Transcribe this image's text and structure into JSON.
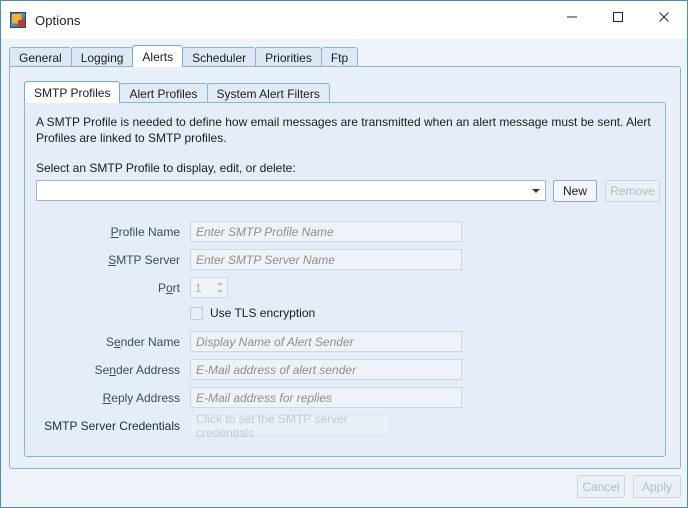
{
  "window": {
    "title": "Options",
    "icon": "app-icon",
    "controls": {
      "minimize": "minimize-icon",
      "maximize": "maximize-icon",
      "close": "close-icon"
    }
  },
  "outer_tabs": [
    {
      "label": "General",
      "selected": false
    },
    {
      "label": "Logging",
      "selected": false
    },
    {
      "label": "Alerts",
      "selected": true
    },
    {
      "label": "Scheduler",
      "selected": false
    },
    {
      "label": "Priorities",
      "selected": false
    },
    {
      "label": "Ftp",
      "selected": false
    }
  ],
  "inner_tabs": [
    {
      "label": "SMTP Profiles",
      "selected": true
    },
    {
      "label": "Alert Profiles",
      "selected": false
    },
    {
      "label": "System Alert Filters",
      "selected": false
    }
  ],
  "content": {
    "description": "A SMTP Profile is needed to define how email messages are transmitted when an alert message must be sent. Alert Profiles are linked to SMTP profiles.",
    "select_label": "Select an SMTP Profile to display, edit, or delete:",
    "combo_value": "",
    "combo_arrow": "chevron-down-icon",
    "new_button": "New",
    "remove_button": "Remove",
    "fields": [
      {
        "label_pre": "P",
        "label_key": "r",
        "label_post": "ofile Name",
        "label_full": "Profile Name",
        "placeholder": "Enter SMTP Profile Name",
        "value": ""
      },
      {
        "label_pre": "S",
        "label_key": "M",
        "label_post": "TP Server",
        "label_full": "SMTP Server",
        "placeholder": "Enter SMTP Server Name",
        "value": ""
      }
    ],
    "port": {
      "label_pre": "P",
      "label_key": "o",
      "label_post": "rt",
      "label_full": "Port",
      "value": "1"
    },
    "tls": {
      "label": "Use TLS encryption",
      "checked": false
    },
    "fields2": [
      {
        "label_pre": "S",
        "label_key": "e",
        "label_post": "nder Name",
        "label_full": "Sender Name",
        "placeholder": "Display Name of Alert Sender",
        "value": ""
      },
      {
        "label_pre": "Se",
        "label_key": "n",
        "label_post": "der Address",
        "label_full": "Sender Address",
        "placeholder": "E-Mail address of alert sender",
        "value": ""
      },
      {
        "label_pre": "",
        "label_key": "R",
        "label_post": "eply Address",
        "label_full": "Reply Address",
        "placeholder": "E-Mail address for replies",
        "value": ""
      }
    ],
    "credentials": {
      "label": "SMTP Server Credentials",
      "button_text": "Click to set the SMTP server credentials"
    }
  },
  "footer": {
    "cancel": "Cancel",
    "apply": "Apply"
  },
  "colors": {
    "window_border": "#4a8db7",
    "panel_bg": "#e9f0f9",
    "inner_panel_bg": "#e4edf8",
    "tab_border": "#8fb3d1",
    "selected_tab_bg": "#ffffff",
    "placeholder_text": "#8e8e8e",
    "disabled_text": "#b3bcc6"
  }
}
